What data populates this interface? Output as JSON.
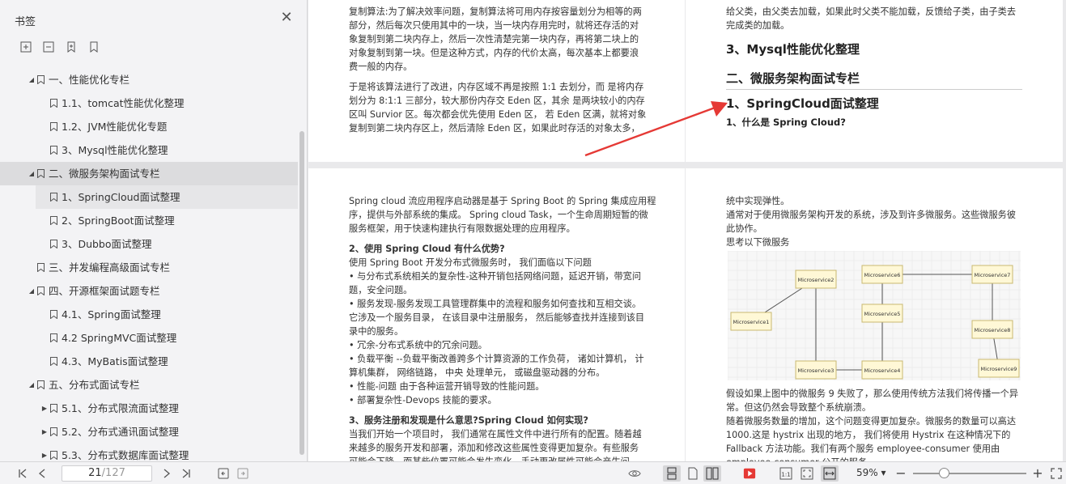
{
  "sidebar": {
    "title": "书签",
    "bookmarks": [
      {
        "level": 1,
        "expanded": true,
        "label": "一、性能优化专栏"
      },
      {
        "level": 2,
        "label": "1.1、tomcat性能优化整理"
      },
      {
        "level": 2,
        "label": "1.2、JVM性能优化专题"
      },
      {
        "level": 2,
        "label": "3、Mysql性能优化整理"
      },
      {
        "level": 1,
        "expanded": true,
        "label": "二、微服务架构面试专栏",
        "selected": true
      },
      {
        "level": 2,
        "label": "1、SpringCloud面试整理",
        "current": true
      },
      {
        "level": 2,
        "label": "2、SpringBoot面试整理"
      },
      {
        "level": 2,
        "label": "3、Dubbo面试整理"
      },
      {
        "level": 1,
        "label": "三、并发编程高级面试专栏"
      },
      {
        "level": 1,
        "expanded": true,
        "label": "四、开源框架面试题专栏"
      },
      {
        "level": 2,
        "label": "4.1、Spring面试整理"
      },
      {
        "level": 2,
        "label": "4.2 SpringMVC面试整理"
      },
      {
        "level": 2,
        "label": "4.3、MyBatis面试整理"
      },
      {
        "level": 1,
        "expanded": true,
        "label": "五、分布式面试专栏"
      },
      {
        "level": 2,
        "collapsed": true,
        "label": "5.1、分布式限流面试整理"
      },
      {
        "level": 2,
        "collapsed": true,
        "label": "5.2、分布式通讯面试整理"
      },
      {
        "level": 2,
        "collapsed": true,
        "label": "5.3、分布式数据库面试整理"
      }
    ]
  },
  "pages": {
    "top_left": {
      "paragraphs": [
        "复制算法:为了解决效率问题，复制算法将可用内存按容量划分为相等的两",
        "部分，然后每次只使用其中的一块，当一块内存用完时，就将还存活的对",
        "象复制到第二块内存上，然后一次性清楚完第一块内存，再将第二块上的",
        "对象复制到第一块。但是这种方式，内存的代价太高，每次基本上都要浪",
        "费一般的内存。",
        "于是将该算法进行了改进，内存区域不再是按照 1:1 去划分，而 是将内存",
        "划分为 8:1:1 三部分，较大那份内存交 Eden 区，其余 是两块较小的内存",
        "区叫 Survior 区。每次都会优先使用 Eden 区， 若 Eden 区满，就将对象",
        "复制到第二块内存区上，然后清除 Eden 区，如果此时存活的对象太多，"
      ]
    },
    "top_right": {
      "lines": [
        "给父类，由父类去加载，如果此时父类不能加载，反馈给子类，由子类去",
        "完成类的加载。"
      ],
      "heading_mysql": "3、Mysql性能优化整理",
      "heading_microservice": "二、微服务架构面试专栏",
      "heading_springcloud": "1、SpringCloud面试整理",
      "question": "1、什么是 Spring Cloud?"
    },
    "bottom_left": {
      "lines": [
        "Spring cloud 流应用程序启动器是基于 Spring Boot 的 Spring 集成应用程",
        "序，提供与外部系统的集成。 Spring cloud Task，一个生命周期短暂的微",
        "服务框架，用于快速构建执行有限数据处理的应用程序。"
      ],
      "q2": "2、使用 Spring Cloud 有什么优势?",
      "q2_lines": [
        "使用 Spring Boot 开发分布式微服务时， 我们面临以下问题",
        "• 与分布式系统相关的复杂性-这种开销包括网络问题，延迟开销，带宽问",
        "题，安全问题。",
        "• 服务发现-服务发现工具管理群集中的流程和服务如何查找和互相交谈。",
        "它涉及一个服务目录， 在该目录中注册服务， 然后能够查找并连接到该目",
        "录中的服务。",
        "• 冗余-分布式系统中的冗余问题。",
        "• 负载平衡 --负载平衡改善跨多个计算资源的工作负荷， 诸如计算机， 计",
        "算机集群， 网络链路， 中央 处理单元， 或磁盘驱动器的分布。",
        "• 性能-问题 由于各种运营开销导致的性能问题。",
        "• 部署复杂性-Devops 技能的要求。"
      ],
      "q3": "3、服务注册和发现是什么意思?Spring Cloud 如何实现?",
      "q3_lines": [
        "当我们开始一个项目时， 我们通常在属性文件中进行所有的配置。随着越",
        "来越多的服务开发和部署，添加和修改这些属性变得更加复杂。有些服务",
        "可能会下降，而某些位置可能会发生变化。手动更改属性可能会产生问"
      ]
    },
    "bottom_right": {
      "lines": [
        "统中实现弹性。",
        "通常对于使用微服务架构开发的系统，涉及到许多微服务。这些微服务彼",
        "此协作。",
        "思考以下微服务"
      ],
      "diagram_nodes": [
        "Microservice1",
        "Microservice2",
        "Microservice3",
        "Microservice4",
        "Microservice5",
        "Microservice6",
        "Microservice7",
        "Microservice8",
        "Microservice9"
      ],
      "after_lines": [
        "假设如果上图中的微服务 9 失败了，那么使用传统方法我们将传播一个异",
        "常。但这仍然会导致整个系统崩溃。",
        "随着微服务数量的增加，这个问题变得更加复杂。微服务的数量可以高达",
        "1000.这是 hystrix 出现的地方， 我们将使用 Hystrix 在这种情况下的",
        "Fallback 方法功能。我们有两个服务 employee-consumer 使用由",
        "employee-consumer 公开的服务。"
      ]
    }
  },
  "toolbar": {
    "current_page": "21",
    "total_pages": "/127",
    "zoom": "59%",
    "zoom_arrow": "▾"
  },
  "colors": {
    "annotation_arrow": "#e53935",
    "play_icon": "#e53935",
    "diagram_node_fill": "#fff8d6",
    "diagram_node_border": "#c8b870"
  }
}
